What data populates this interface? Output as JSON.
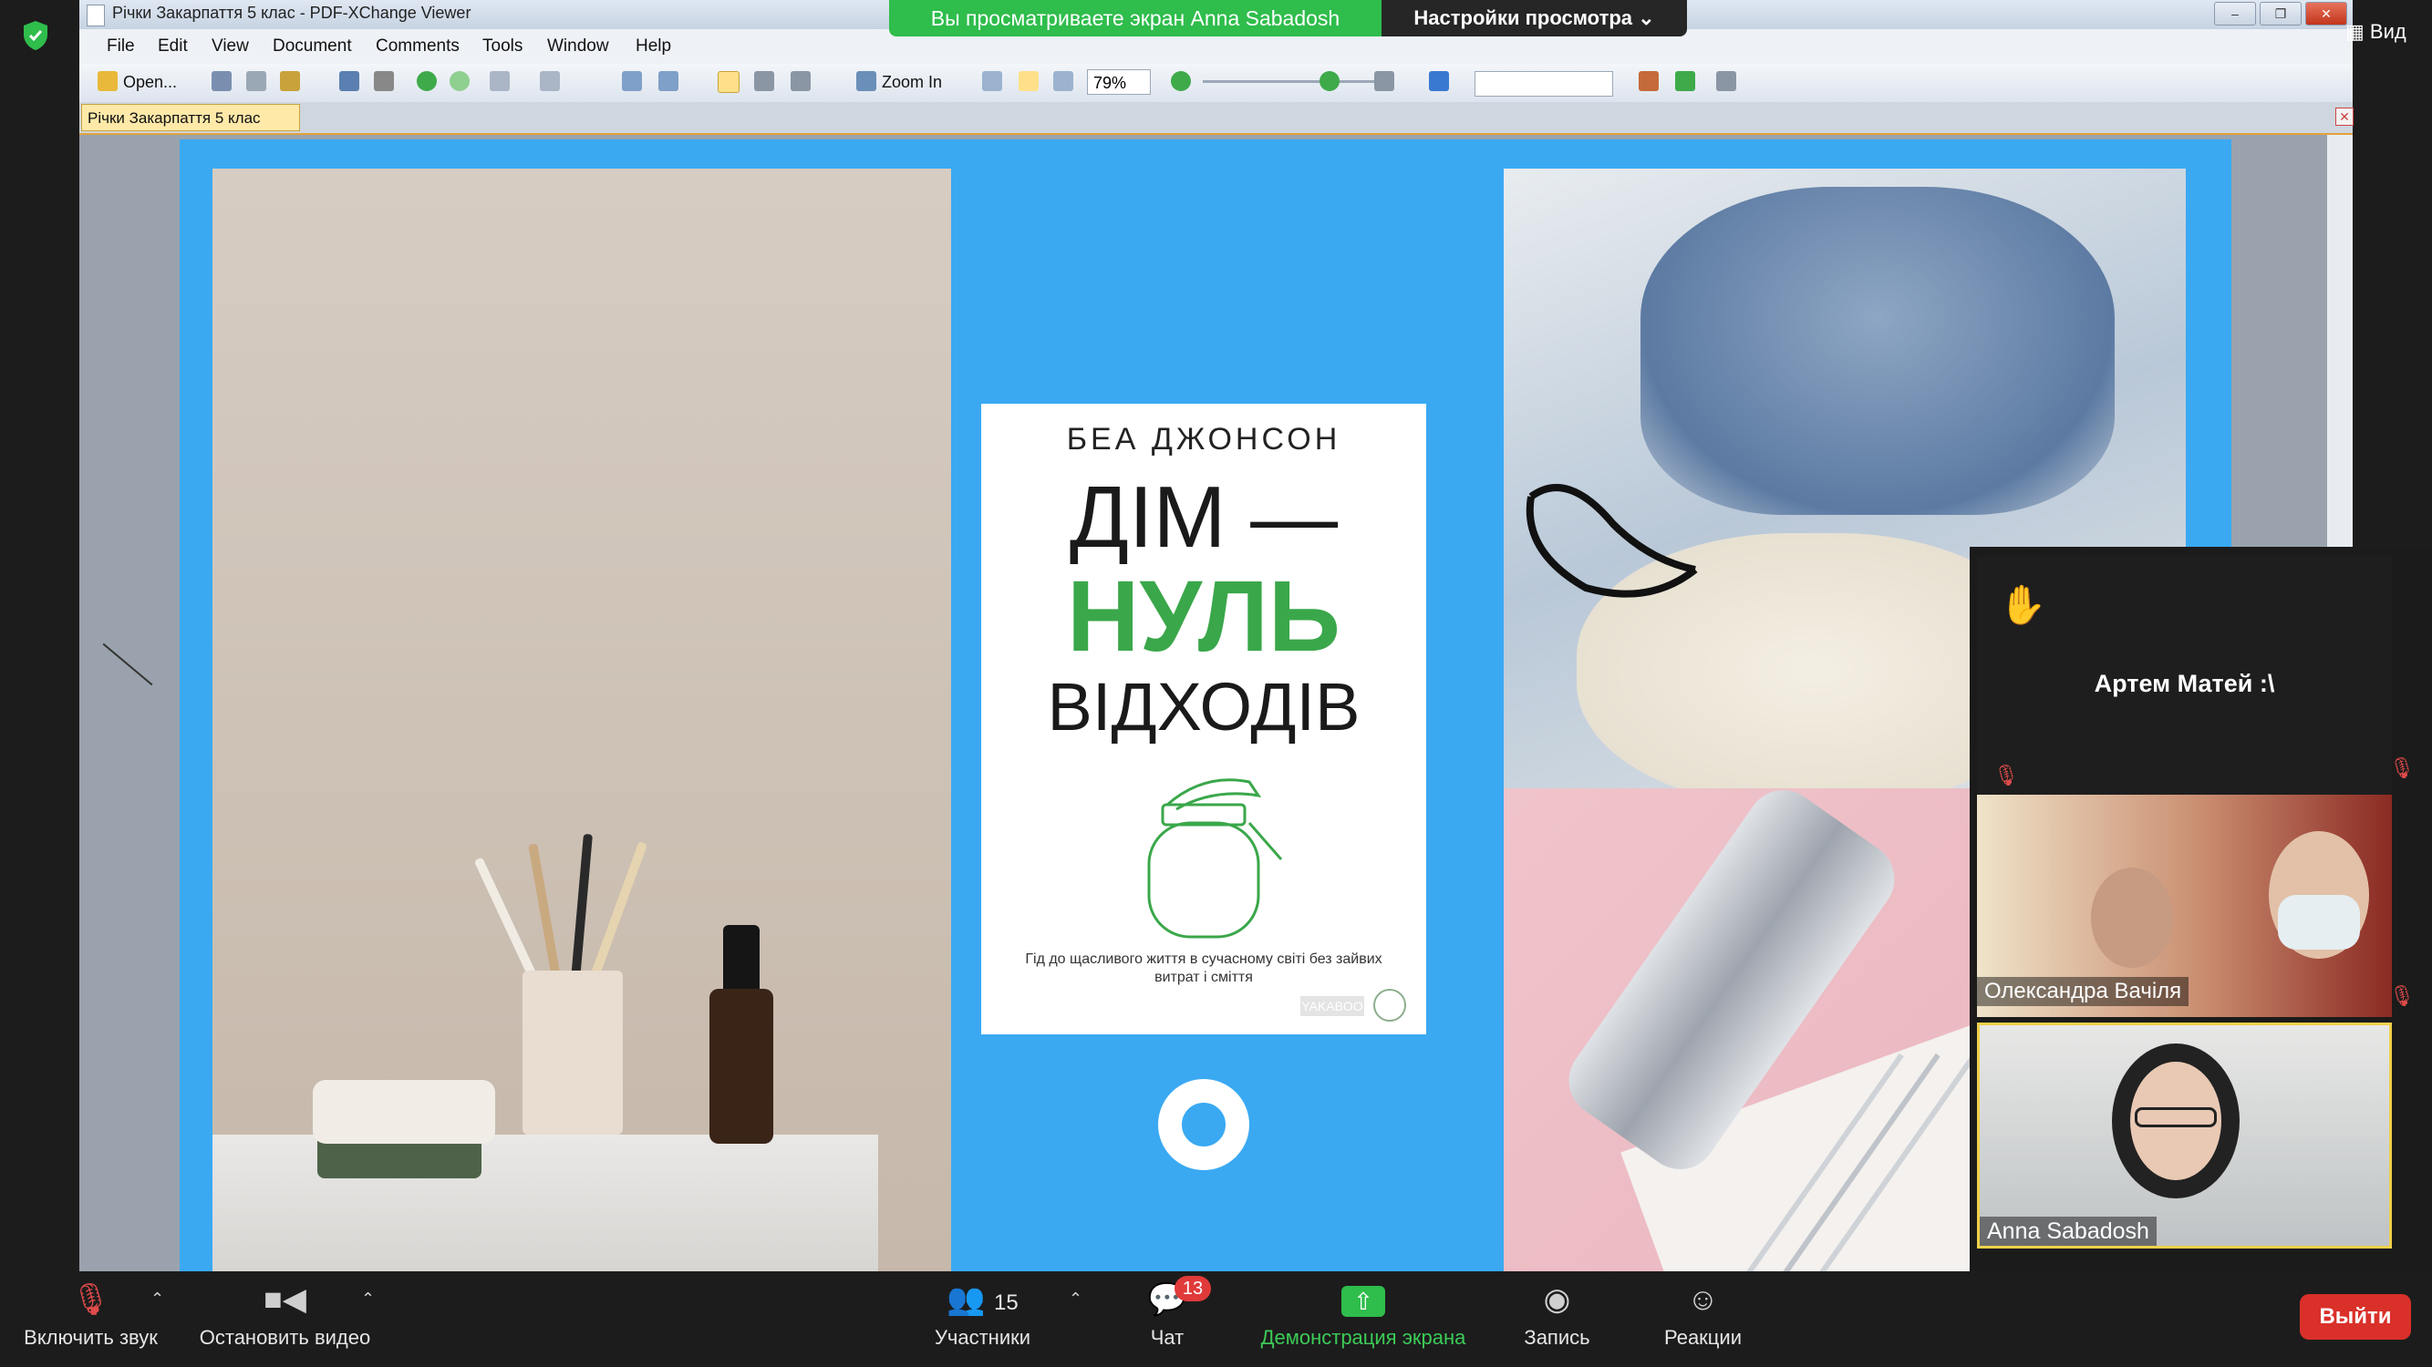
{
  "zoom": {
    "share_banner": "Вы просматриваете экран Anna Sabadosh",
    "view_settings": "Настройки просмотра",
    "view_button": "Вид",
    "bottom": {
      "unmute": "Включить звук",
      "stop_video": "Остановить видео",
      "participants": "Участники",
      "participants_count": "15",
      "chat": "Чат",
      "chat_badge": "13",
      "share_screen": "Демонстрация экрана",
      "record": "Запись",
      "reactions": "Реакции",
      "leave": "Выйти"
    },
    "tiles": {
      "raised_hand_name": "Артем Матей :\\",
      "video_a_name": "Олександра Вачіля",
      "video_b_name": "Anna Sabadosh"
    }
  },
  "pdf": {
    "title": "Річки Закарпаття 5 клас - PDF-XChange Viewer",
    "menu": [
      "File",
      "Edit",
      "View",
      "Document",
      "Comments",
      "Tools",
      "Window",
      "Help"
    ],
    "toolbar": {
      "open_label": "Open...",
      "zoom_in_label": "Zoom In",
      "zoom_value": "79%"
    },
    "tab_title": "Річки Закарпаття 5 клас"
  },
  "book": {
    "author": "БЕА ДЖОНСОН",
    "title_line1": "ДІМ —",
    "title_line2": "НУЛЬ",
    "title_line3": "ВІДХОДІВ",
    "subtitle": "Гід до щасливого життя в сучасному світі без зайвих витрат і сміття",
    "publisher": "YAKABOO"
  },
  "colors": {
    "slide_background": "#3aa9f2",
    "share_banner": "#2fbd4c",
    "book_green": "#3aa74a",
    "leave_button": "#d9302a"
  }
}
